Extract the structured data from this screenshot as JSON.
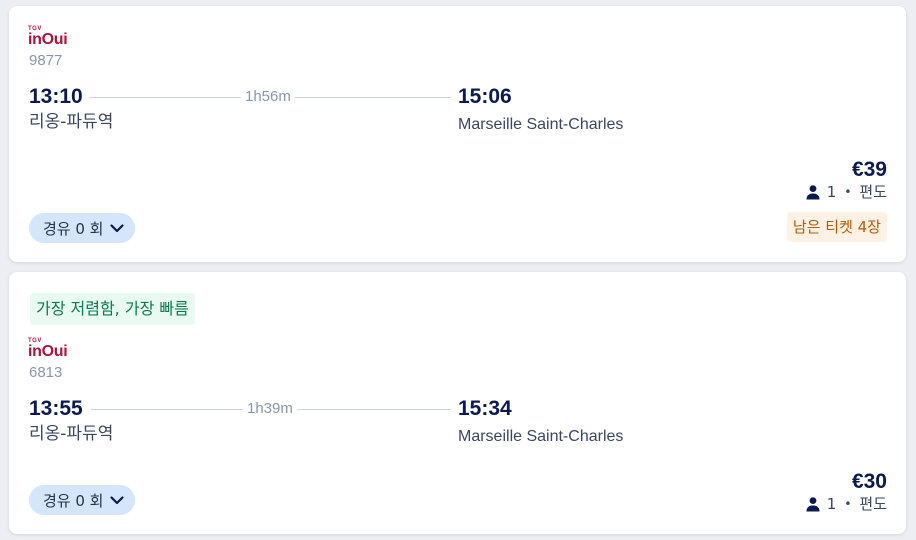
{
  "results": [
    {
      "operator_logo_small": "TGV",
      "operator_logo_main": "inOui",
      "train_number": "9877",
      "depart_time": "13:10",
      "duration": "1h56m",
      "arrive_time": "15:06",
      "origin": "리옹-파듀역",
      "destination": "Marseille Saint-Charles",
      "price": "€39",
      "passengers": "1",
      "trip_type": "편도",
      "stops_label": "경유 0 회",
      "tickets_left": "남은 티켓 4장"
    },
    {
      "highlight": "가장 저렴함, 가장 빠름",
      "operator_logo_small": "TGV",
      "operator_logo_main": "inOui",
      "train_number": "6813",
      "depart_time": "13:55",
      "duration": "1h39m",
      "arrive_time": "15:34",
      "origin": "리옹-파듀역",
      "destination": "Marseille Saint-Charles",
      "price": "€30",
      "passengers": "1",
      "trip_type": "편도",
      "stops_label": "경유 0 회"
    }
  ],
  "icons": {
    "person": "person-icon",
    "chevron": "chevron-down-icon"
  },
  "colors": {
    "primary_text": "#0c1b4d",
    "logo": "#a8163c",
    "highlight_bg": "#e8faf2",
    "highlight_text": "#0a7a54",
    "stops_bg": "#d5e5fb",
    "tickets_left_bg": "#fff1e3",
    "tickets_left_text": "#b45a0a"
  }
}
